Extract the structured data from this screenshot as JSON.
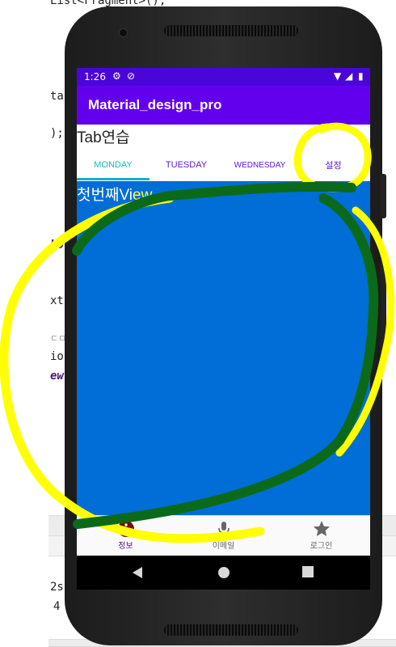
{
  "background_code": {
    "line1": "List<Fragment>();",
    "line2": "ta",
    "line3": ");",
    "line4": "bo",
    "line5": "xt",
    "line6": "ㄷㅁ",
    "line7": "io",
    "line8": "ew",
    "line9": "2s",
    "line10": "4"
  },
  "status_bar": {
    "time": "1:26"
  },
  "app_bar": {
    "title": "Material_design_pro"
  },
  "section_title": "Tab연습",
  "tabs": [
    {
      "label": "MONDAY",
      "active": true
    },
    {
      "label": "TUESDAY",
      "active": false
    },
    {
      "label": "WEDNESDAY",
      "active": false
    },
    {
      "label": "설정",
      "active": false
    }
  ],
  "content": {
    "label_main": "첫번째Vi",
    "label_tail": "ew",
    "background_color": "#006ed6"
  },
  "bottom_nav": [
    {
      "label": "정보",
      "icon": "info-icon",
      "active": true
    },
    {
      "label": "이메일",
      "icon": "mic-icon",
      "active": false
    },
    {
      "label": "로그인",
      "icon": "star-icon",
      "active": false
    }
  ],
  "colors": {
    "status_bar": "#4a06d8",
    "app_bar": "#6200ee",
    "tab_active": "#0fbfb0",
    "tab_inactive": "#5b16d0",
    "annotation_yellow": "#ffff00",
    "annotation_green": "#0b6a1a"
  }
}
